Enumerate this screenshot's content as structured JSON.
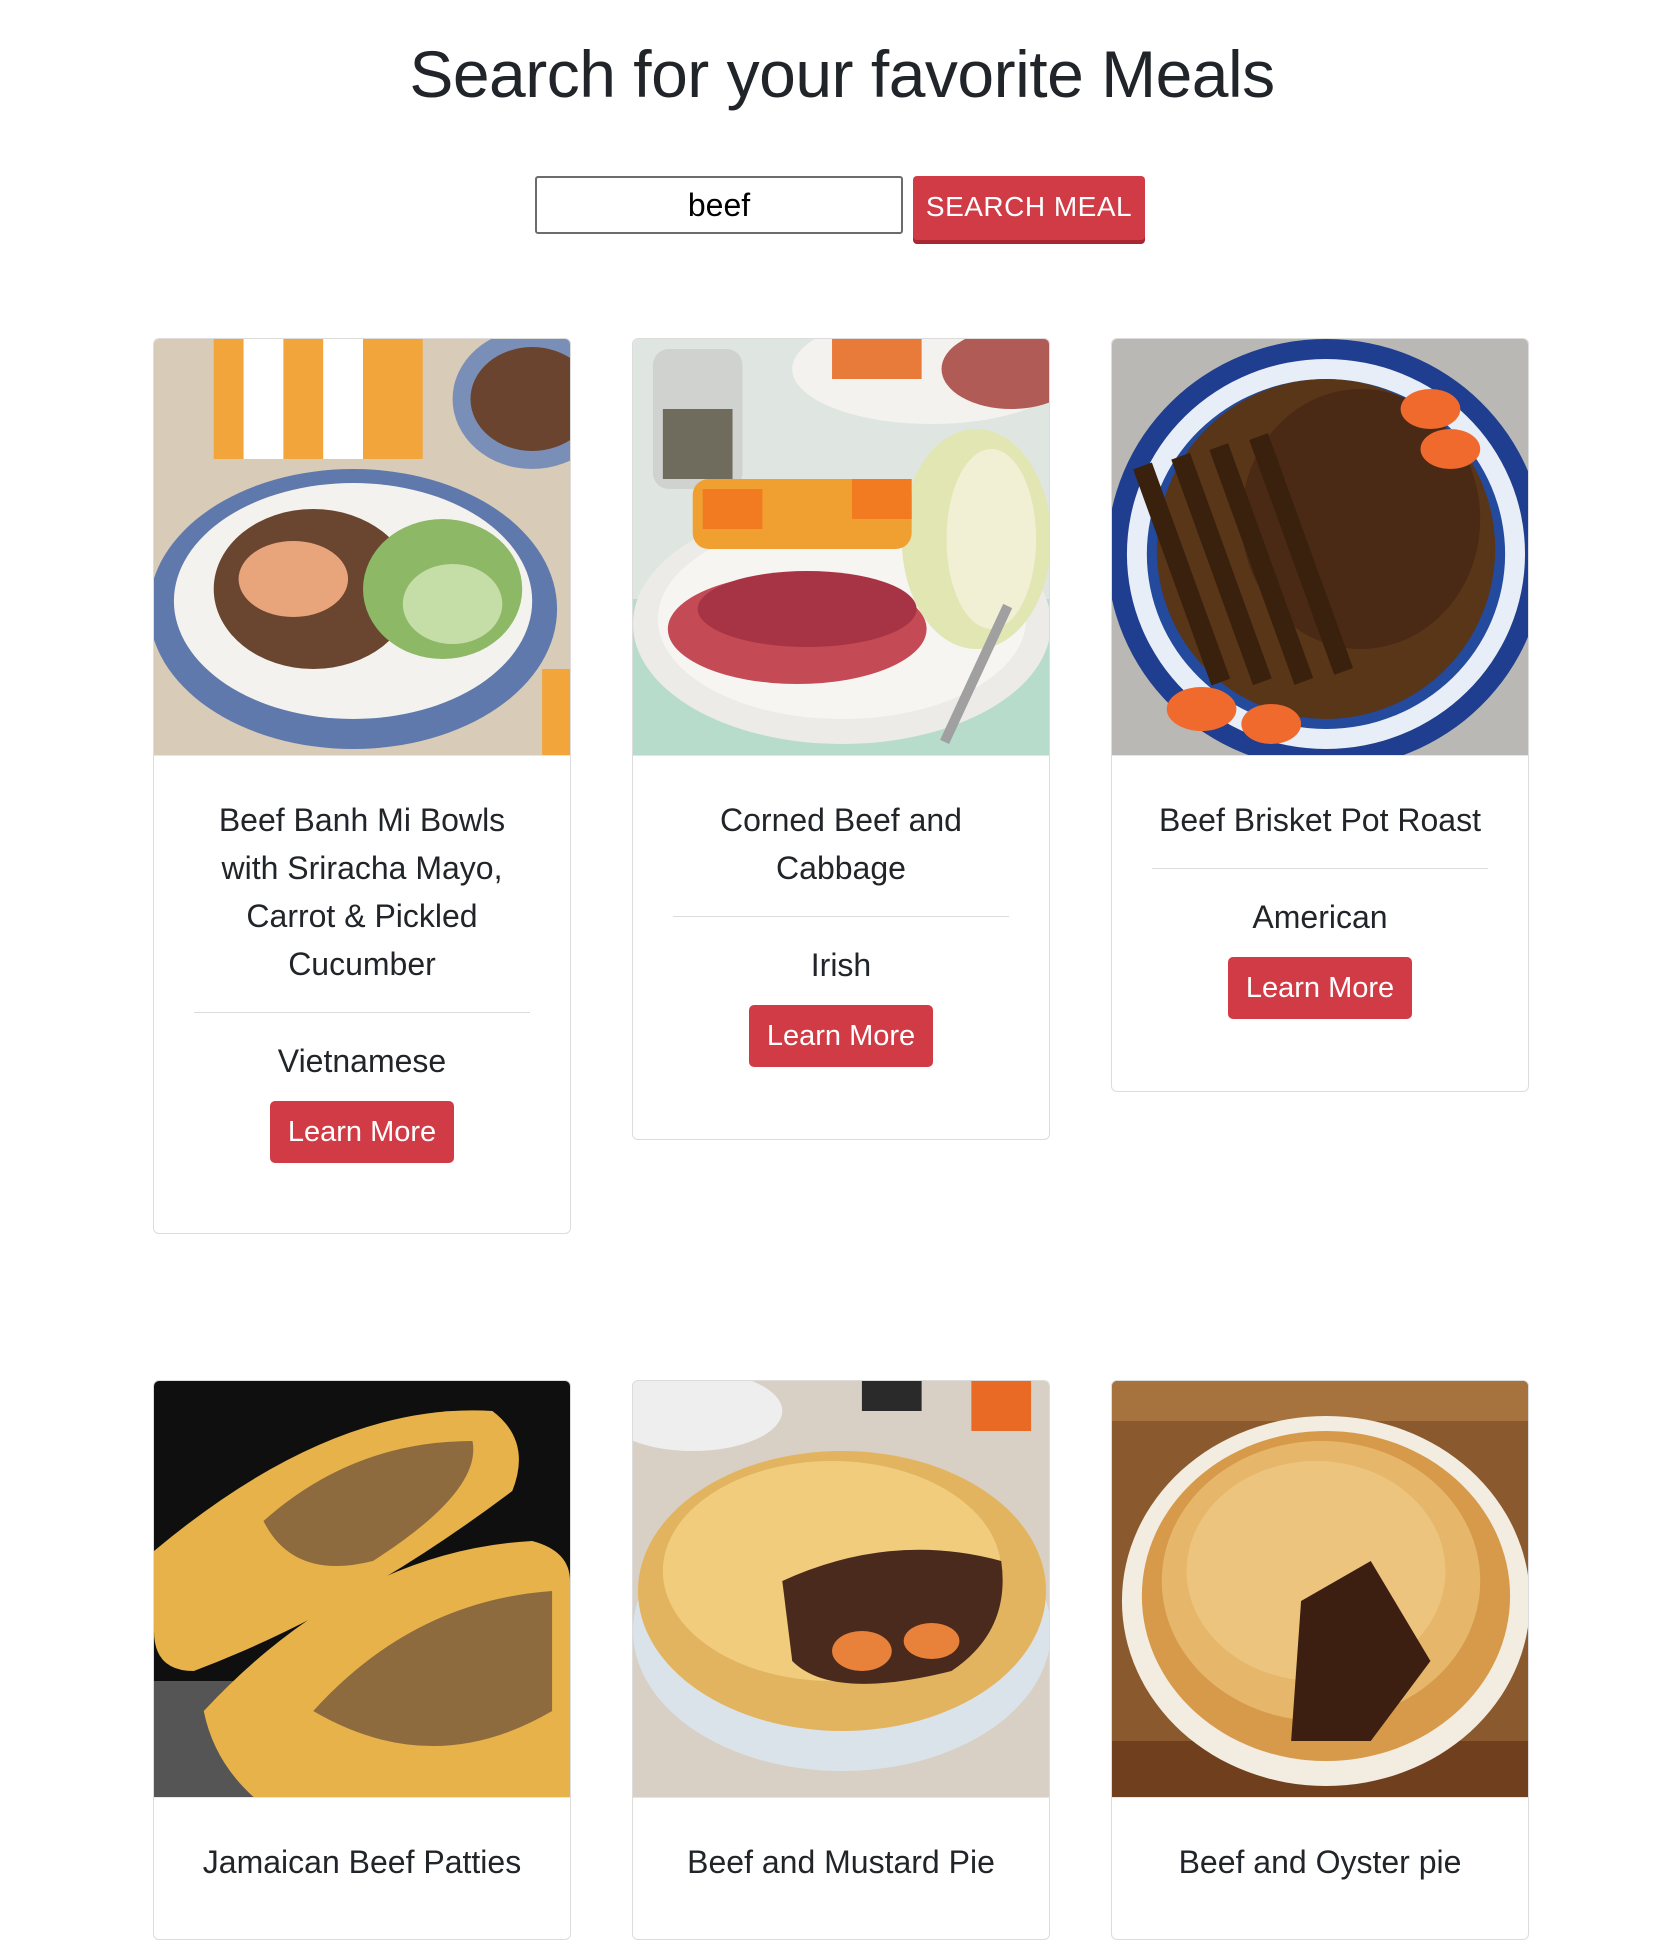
{
  "header": {
    "title": "Search for your favorite Meals"
  },
  "search": {
    "value": "beef",
    "button_label": "SEARCH MEAL"
  },
  "meals": [
    {
      "title": "Beef Banh Mi Bowls with Sriracha Mayo, Carrot & Pickled Cucumber",
      "area": "Vietnamese",
      "button_label": "Learn More"
    },
    {
      "title": "Corned Beef and Cabbage",
      "area": "Irish",
      "button_label": "Learn More"
    },
    {
      "title": "Beef Brisket Pot Roast",
      "area": "American",
      "button_label": "Learn More"
    },
    {
      "title": "Jamaican Beef Patties"
    },
    {
      "title": "Beef and Mustard Pie"
    },
    {
      "title": "Beef and Oyster pie"
    }
  ],
  "colors": {
    "accent": "#d13b46",
    "text": "#212529"
  }
}
